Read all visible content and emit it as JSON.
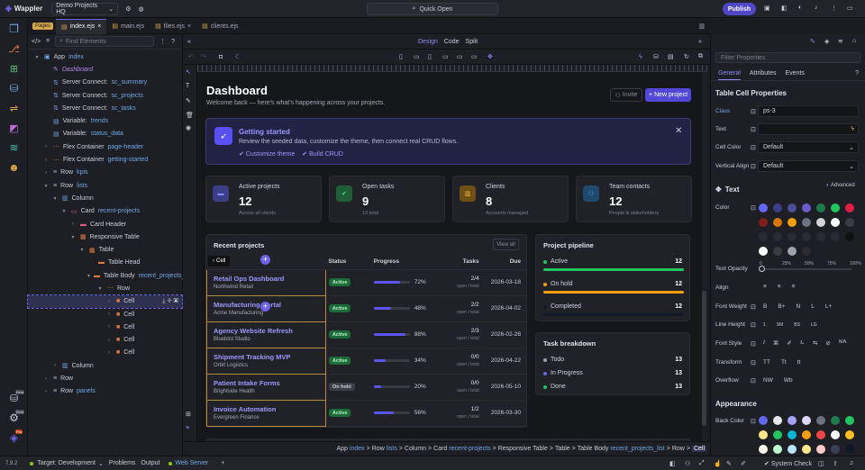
{
  "app": {
    "name": "Wappler",
    "project": "Demo Projects HQ",
    "quick_open": "Quick Open",
    "publish": "Publish"
  },
  "files": {
    "pages_tag": "Pages",
    "tabs": [
      "index.ejs",
      "main.ejs",
      "files.ejs",
      "clients.ejs"
    ]
  },
  "left": {
    "find_placeholder": "Find Elements",
    "tree": [
      {
        "indent": 0,
        "arrow": "▾",
        "kind": "app",
        "name": "App",
        "sub": "index"
      },
      {
        "indent": 1,
        "arrow": "",
        "kind": "ital",
        "name": "Dashboard",
        "sub": ""
      },
      {
        "indent": 1,
        "arrow": "",
        "kind": "server",
        "name": "Server Connect:",
        "sub": "sc_summary"
      },
      {
        "indent": 1,
        "arrow": "",
        "kind": "server",
        "name": "Server Connect:",
        "sub": "sc_projects"
      },
      {
        "indent": 1,
        "arrow": "",
        "kind": "server",
        "name": "Server Connect:",
        "sub": "sc_tasks"
      },
      {
        "indent": 1,
        "arrow": "",
        "kind": "var",
        "name": "Variable:",
        "sub": "trends"
      },
      {
        "indent": 1,
        "arrow": "",
        "kind": "var",
        "name": "Variable:",
        "sub": "status_data"
      },
      {
        "indent": 1,
        "arrow": "›",
        "kind": "flex",
        "name": "Flex Container",
        "sub": "page-header"
      },
      {
        "indent": 1,
        "arrow": "›",
        "kind": "flex",
        "name": "Flex Container",
        "sub": "getting-started"
      },
      {
        "indent": 1,
        "arrow": "›",
        "kind": "row",
        "name": "Row",
        "sub": "kpis"
      },
      {
        "indent": 1,
        "arrow": "▾",
        "kind": "row",
        "name": "Row",
        "sub": "lists"
      },
      {
        "indent": 2,
        "arrow": "▾",
        "kind": "col",
        "name": "Column",
        "sub": ""
      },
      {
        "indent": 3,
        "arrow": "▾",
        "kind": "card",
        "name": "Card",
        "sub": "recent-projects"
      },
      {
        "indent": 4,
        "arrow": "›",
        "kind": "ch",
        "name": "Card Header",
        "sub": ""
      },
      {
        "indent": 4,
        "arrow": "▾",
        "kind": "rt",
        "name": "Responsive Table",
        "sub": ""
      },
      {
        "indent": 5,
        "arrow": "▾",
        "kind": "tbl",
        "name": "Table",
        "sub": ""
      },
      {
        "indent": 6,
        "arrow": "",
        "kind": "th",
        "name": "Table Head",
        "sub": ""
      },
      {
        "indent": 6,
        "arrow": "▾",
        "kind": "tb",
        "name": "Table Body",
        "sub": "recent_projects_list"
      },
      {
        "indent": 7,
        "arrow": "▾",
        "kind": "trow",
        "name": "Row",
        "sub": ""
      },
      {
        "indent": 8,
        "arrow": "›",
        "kind": "cell",
        "name": "Cell",
        "sub": "",
        "sel": true
      },
      {
        "indent": 8,
        "arrow": "›",
        "kind": "cell",
        "name": "Cell",
        "sub": ""
      },
      {
        "indent": 8,
        "arrow": "›",
        "kind": "cell",
        "name": "Cell",
        "sub": ""
      },
      {
        "indent": 8,
        "arrow": "›",
        "kind": "cell",
        "name": "Cell",
        "sub": ""
      },
      {
        "indent": 8,
        "arrow": "›",
        "kind": "cell",
        "name": "Cell",
        "sub": ""
      },
      {
        "indent": 2,
        "arrow": "›",
        "kind": "col",
        "name": "Column",
        "sub": ""
      },
      {
        "indent": 1,
        "arrow": "›",
        "kind": "row",
        "name": "Row",
        "sub": ""
      },
      {
        "indent": 1,
        "arrow": "›",
        "kind": "row",
        "name": "Row",
        "sub": "panels"
      }
    ],
    "rail_badges": {
      "db": "Beta",
      "gear": "Beta",
      "user": "Pro"
    }
  },
  "center": {
    "modes": [
      "Design",
      "Code",
      "Split"
    ],
    "active_mode": "Design"
  },
  "dash": {
    "title": "Dashboard",
    "lead": "Welcome back — here's what's happening across your projects.",
    "invite": "Invite",
    "new_project": "New project",
    "getting_started": {
      "title": "Getting started",
      "desc": "Review the seeded data, customize the theme, then connect real CRUD flows.",
      "link1": "Customize theme",
      "link2": "Build CRUD"
    },
    "kpis": [
      {
        "label": "Active projects",
        "value": "12",
        "sub": "Across all clients",
        "color": "#3b3f8a",
        "icon": "folder-icon"
      },
      {
        "label": "Open tasks",
        "value": "9",
        "sub": "13 total",
        "color": "#1f5e36",
        "icon": "check-icon"
      },
      {
        "label": "Clients",
        "value": "8",
        "sub": "Accounts managed",
        "color": "#6e4f16",
        "icon": "building-icon"
      },
      {
        "label": "Team contacts",
        "value": "12",
        "sub": "People & stakeholders",
        "color": "#1e4a6e",
        "icon": "people-icon"
      }
    ],
    "recent": {
      "title": "Recent projects",
      "view_all": "View all",
      "hint": "Cell",
      "cols": [
        "",
        "Status",
        "Progress",
        "Tasks",
        "Due"
      ],
      "rows": [
        {
          "name": "Retail Ops Dashboard",
          "client": "Northwind Retail",
          "status": "Active",
          "progress": 72,
          "pct": "72%",
          "tasks": "2/4",
          "tasks_sub": "open / total",
          "due": "2026-03-18"
        },
        {
          "name": "Manufacturing Portal",
          "client": "Acme Manufacturing",
          "status": "Active",
          "progress": 48,
          "pct": "48%",
          "tasks": "2/2",
          "tasks_sub": "open / total",
          "due": "2026-04-02"
        },
        {
          "name": "Agency Website Refresh",
          "client": "Bluebird Studio",
          "status": "Active",
          "progress": 88,
          "pct": "88%",
          "tasks": "2/3",
          "tasks_sub": "open / total",
          "due": "2026-02-28"
        },
        {
          "name": "Shipment Tracking MVP",
          "client": "Orbit Logistics",
          "status": "Active",
          "progress": 34,
          "pct": "34%",
          "tasks": "0/0",
          "tasks_sub": "open / total",
          "due": "2026-04-22"
        },
        {
          "name": "Patient Intake Forms",
          "client": "Brightside Health",
          "status": "On hold",
          "progress": 20,
          "pct": "20%",
          "tasks": "0/0",
          "tasks_sub": "open / total",
          "due": "2026-05-10"
        },
        {
          "name": "Invoice Automation",
          "client": "Evergreen Finance",
          "status": "Active",
          "progress": 56,
          "pct": "56%",
          "tasks": "1/2",
          "tasks_sub": "open / total",
          "due": "2026-03-30"
        }
      ]
    },
    "pipeline": {
      "title": "Project pipeline",
      "items": [
        {
          "label": "Active",
          "value": "12",
          "fill": 1.0,
          "color": "#22c55e"
        },
        {
          "label": "On hold",
          "value": "12",
          "fill": 1.0,
          "color": "#f59e0b"
        },
        {
          "label": "Completed",
          "value": "12",
          "fill": 1.0,
          "color": "#111827"
        }
      ]
    },
    "breakdown": {
      "title": "Task breakdown",
      "items": [
        {
          "label": "Todo",
          "value": "13",
          "color": "#9ca3af"
        },
        {
          "label": "In Progress",
          "value": "13",
          "color": "#6366f1"
        },
        {
          "label": "Done",
          "value": "13",
          "color": "#22c55e"
        }
      ]
    }
  },
  "crumbs": [
    {
      "t": "App",
      "s": "index"
    },
    {
      "t": "Row",
      "s": "lists"
    },
    {
      "t": "Column",
      "s": ""
    },
    {
      "t": "Card",
      "s": "recent-projects"
    },
    {
      "t": "Responsive Table",
      "s": ""
    },
    {
      "t": "Table",
      "s": ""
    },
    {
      "t": "Table Body",
      "s": "recent_projects_list"
    },
    {
      "t": "Row",
      "s": ""
    }
  ],
  "crumb_last": "Cell",
  "right": {
    "filter_placeholder": "Filter Properties",
    "tabs": [
      "General",
      "Attributes",
      "Events"
    ],
    "section": "Table Cell Properties",
    "class_label": "Class",
    "class_value": "ps-3",
    "text_label": "Text",
    "cell_color_label": "Cell Color",
    "cell_color_value": "Default",
    "valign_label": "Vertical Align",
    "valign_value": "Default",
    "text_head": "Text",
    "advanced": "Advanced",
    "color_label": "Color",
    "opacity_label": "Text Opacity",
    "opacity_ticks": [
      "0",
      "25%",
      "50%",
      "75%",
      "100%"
    ],
    "align_label": "Align",
    "weight_label": "Font Weight",
    "weights": [
      "B",
      "B+",
      "N",
      "L",
      "L+"
    ],
    "height_label": "Line Height",
    "heights": [
      "1",
      "SM",
      "BS",
      "LG"
    ],
    "style_label": "Font Style",
    "style_na": "N/A",
    "transform_label": "Transform",
    "transforms": [
      "TT",
      "Tt",
      "tt"
    ],
    "overflow_label": "Overflow",
    "overflows": [
      "NW",
      "Wb"
    ],
    "appearance": "Appearance",
    "back_label": "Back Color"
  },
  "status": {
    "version": "7.9.2",
    "target": "Target: Development",
    "problems": "Problems",
    "output": "Output",
    "web_server": "Web Server",
    "system_check": "System Check"
  }
}
